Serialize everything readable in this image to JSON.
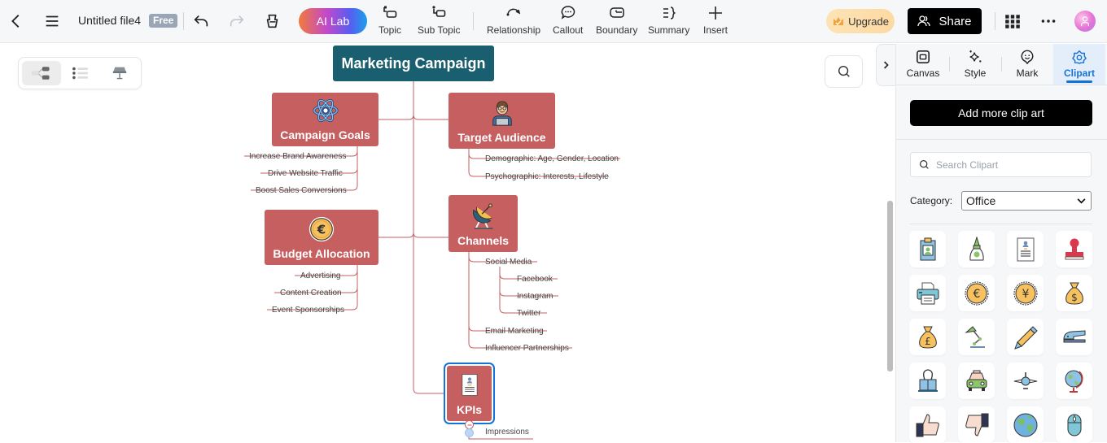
{
  "topbar": {
    "file_title": "Untitled file4",
    "plan_badge": "Free",
    "ai_lab_label": "AI Lab",
    "tools": [
      {
        "id": "topic",
        "label": "Topic",
        "icon": "topic-icon"
      },
      {
        "id": "sub-topic",
        "label": "Sub Topic",
        "icon": "sub-topic-icon"
      },
      {
        "id": "relationship",
        "label": "Relationship",
        "icon": "relationship-icon"
      },
      {
        "id": "callout",
        "label": "Callout",
        "icon": "callout-icon"
      },
      {
        "id": "boundary",
        "label": "Boundary",
        "icon": "boundary-icon"
      },
      {
        "id": "summary",
        "label": "Summary",
        "icon": "summary-icon"
      },
      {
        "id": "insert",
        "label": "Insert",
        "icon": "plus-icon"
      }
    ],
    "upgrade_label": "Upgrade",
    "share_label": "Share"
  },
  "canvas": {
    "view_modes": [
      "mind-map",
      "outline",
      "presentation"
    ],
    "active_view": "mind-map"
  },
  "mindmap": {
    "root": "Marketing Campaign",
    "colors": {
      "root": "#1a5f70",
      "topic": "#c65f60",
      "line": "#c65f60",
      "selection": "#1673d6"
    },
    "topics": {
      "goals": {
        "label": "Campaign Goals",
        "icon": "atom-icon",
        "children": [
          "Increase Brand Awareness",
          "Drive Website Traffic",
          "Boost Sales Conversions"
        ]
      },
      "audience": {
        "label": "Target Audience",
        "icon": "person-laptop-icon",
        "children": [
          "Demographic: Age, Gender, Location",
          "Psychographic: Interests, Lifestyle"
        ]
      },
      "budget": {
        "label": "Budget Allocation",
        "icon": "euro-coin-icon",
        "children": [
          "Advertising",
          "Content Creation",
          "Event Sponsorships"
        ]
      },
      "channels": {
        "label": "Channels",
        "icon": "satellite-dish-icon",
        "children": [
          "Social Media",
          "Email Marketing",
          "Influencer Partnerships"
        ],
        "social_children": [
          "Facebook",
          "Instagram",
          "Twitter"
        ]
      },
      "kpis": {
        "label": "KPIs",
        "icon": "resume-document-icon",
        "selected": true,
        "children": [
          "Impressions"
        ]
      }
    }
  },
  "panel": {
    "tabs": [
      {
        "label": "Canvas",
        "icon": "canvas-icon"
      },
      {
        "label": "Style",
        "icon": "sparkle-icon"
      },
      {
        "label": "Mark",
        "icon": "smiley-pin-icon"
      },
      {
        "label": "Clipart",
        "icon": "flower-icon"
      }
    ],
    "active_tab": "Clipart",
    "add_clipart_label": "Add more clip art",
    "search_placeholder": "Search Clipart",
    "category_label": "Category:",
    "category_value": "Office",
    "clipart": [
      "id-badge",
      "glue-bottle",
      "resume",
      "rubber-stamp",
      "printer",
      "euro-coin",
      "yen-coin",
      "dollar-bag",
      "pound-bag",
      "desk-lamp",
      "pencil",
      "stapler",
      "binder-clip",
      "taxi",
      "airplane",
      "globe-stand",
      "thumbs-up",
      "thumbs-down",
      "earth",
      "computer-mouse"
    ]
  }
}
